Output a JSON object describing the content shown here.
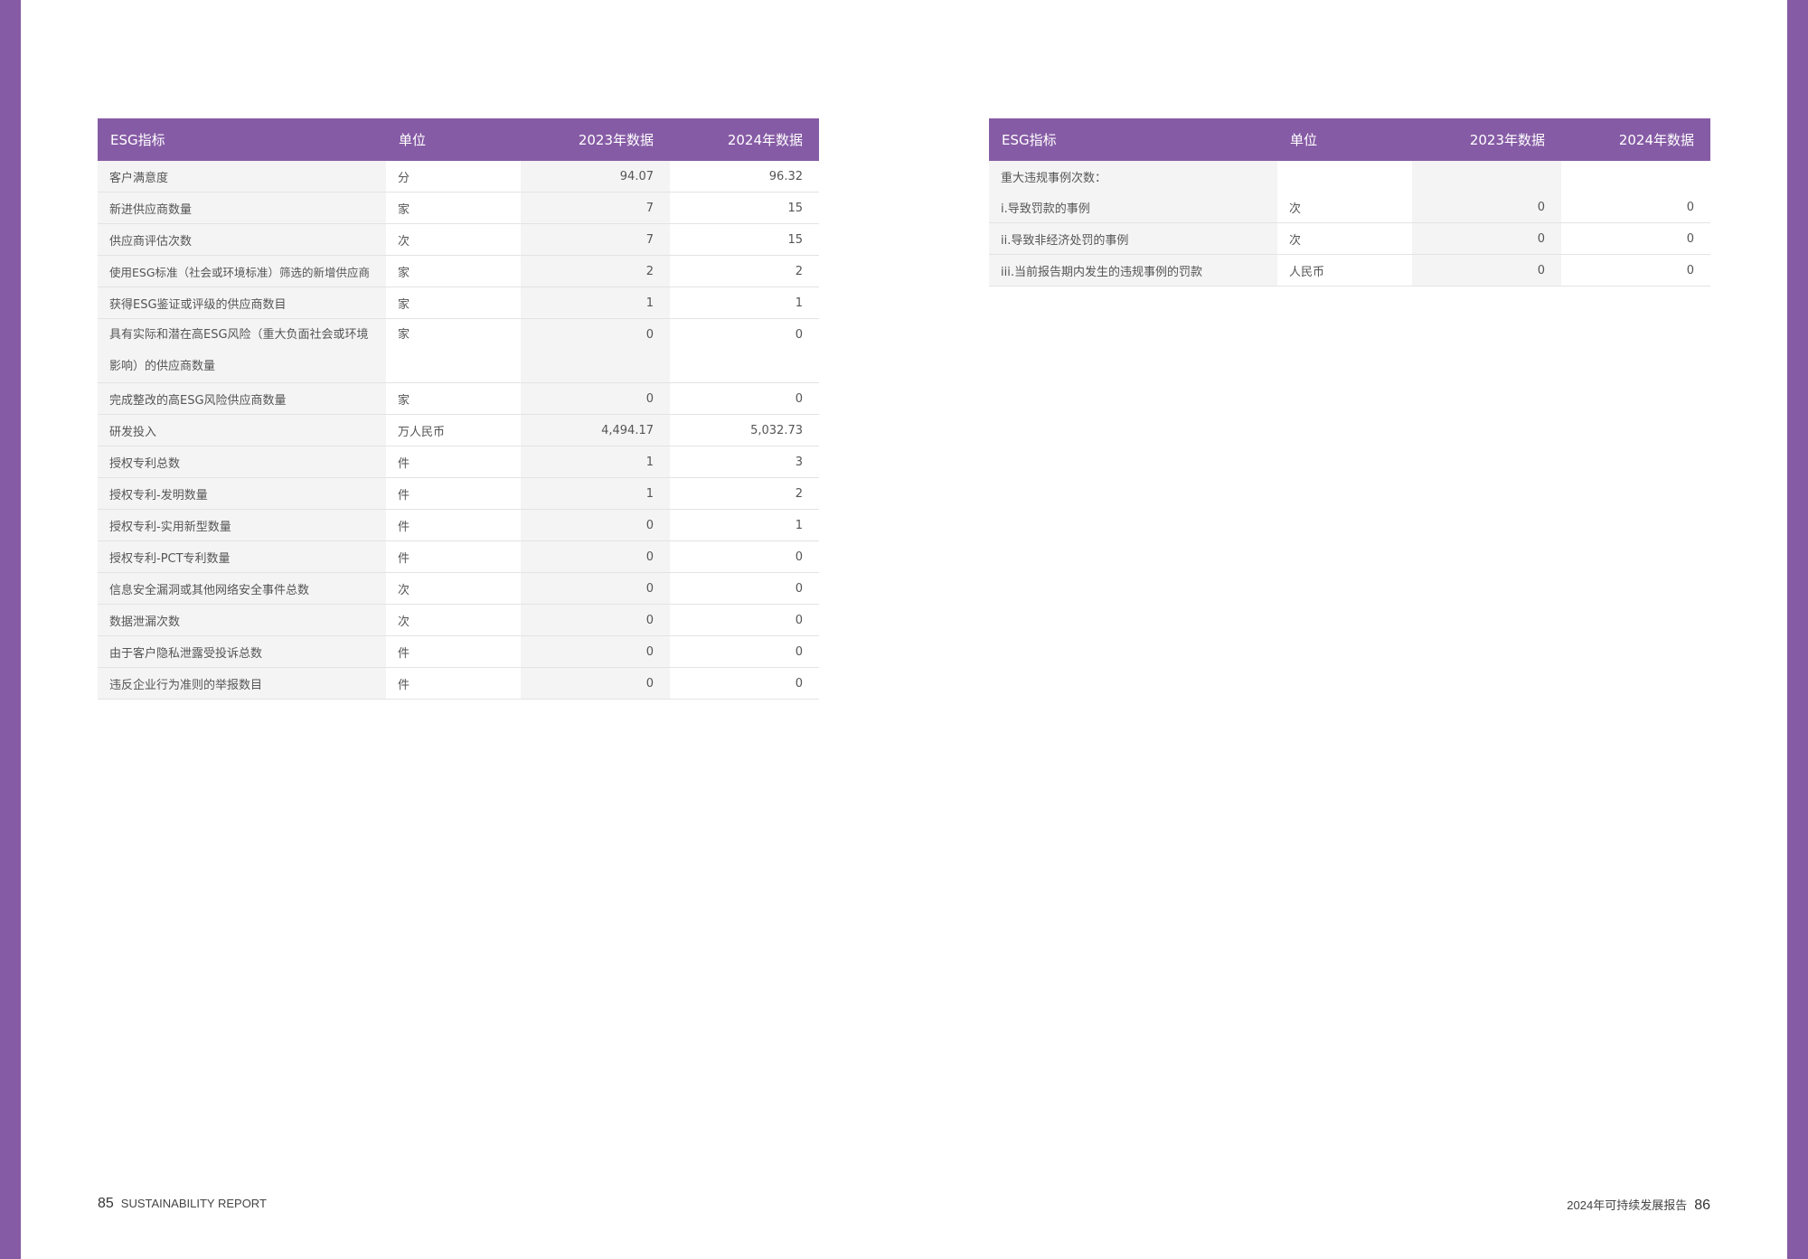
{
  "colors": {
    "accent": "#865ba5"
  },
  "left_table": {
    "headers": [
      "ESG指标",
      "单位",
      "2023年数据",
      "2024年数据"
    ],
    "rows": [
      [
        "客户满意度",
        "分",
        "94.07",
        "96.32"
      ],
      [
        "新进供应商数量",
        "家",
        "7",
        "15"
      ],
      [
        "供应商评估次数",
        "次",
        "7",
        "15"
      ],
      [
        "使用ESG标准（社会或环境标准）筛选的新增供应商",
        "家",
        "2",
        "2"
      ],
      [
        "获得ESG鉴证或评级的供应商数目",
        "家",
        "1",
        "1"
      ],
      [
        "具有实际和潜在高ESG风险（重大负面社会或环境影响）的供应商数量",
        "家",
        "0",
        "0"
      ],
      [
        "完成整改的高ESG风险供应商数量",
        "家",
        "0",
        "0"
      ],
      [
        "研发投入",
        "万人民币",
        "4,494.17",
        "5,032.73"
      ],
      [
        "授权专利总数",
        "件",
        "1",
        "3"
      ],
      [
        "授权专利-发明数量",
        "件",
        "1",
        "2"
      ],
      [
        "授权专利-实用新型数量",
        "件",
        "0",
        "1"
      ],
      [
        "授权专利-PCT专利数量",
        "件",
        "0",
        "0"
      ],
      [
        "信息安全漏洞或其他网络安全事件总数",
        "次",
        "0",
        "0"
      ],
      [
        "数据泄漏次数",
        "次",
        "0",
        "0"
      ],
      [
        "由于客户隐私泄露受投诉总数",
        "件",
        "0",
        "0"
      ],
      [
        "违反企业行为准则的举报数目",
        "件",
        "0",
        "0"
      ]
    ]
  },
  "right_table": {
    "headers": [
      "ESG指标",
      "单位",
      "2023年数据",
      "2024年数据"
    ],
    "rows": [
      [
        "重大违规事例次数：",
        "",
        "",
        ""
      ],
      [
        "i.导致罚款的事例",
        "次",
        "0",
        "0"
      ],
      [
        "ii.导致非经济处罚的事例",
        "次",
        "0",
        "0"
      ],
      [
        "iii.当前报告期内发生的违规事例的罚款",
        "人民币",
        "0",
        "0"
      ]
    ]
  },
  "footer": {
    "left_page": "85",
    "left_text": "SUSTAINABILITY REPORT",
    "right_text": "2024年可持续发展报告",
    "right_page": "86"
  }
}
